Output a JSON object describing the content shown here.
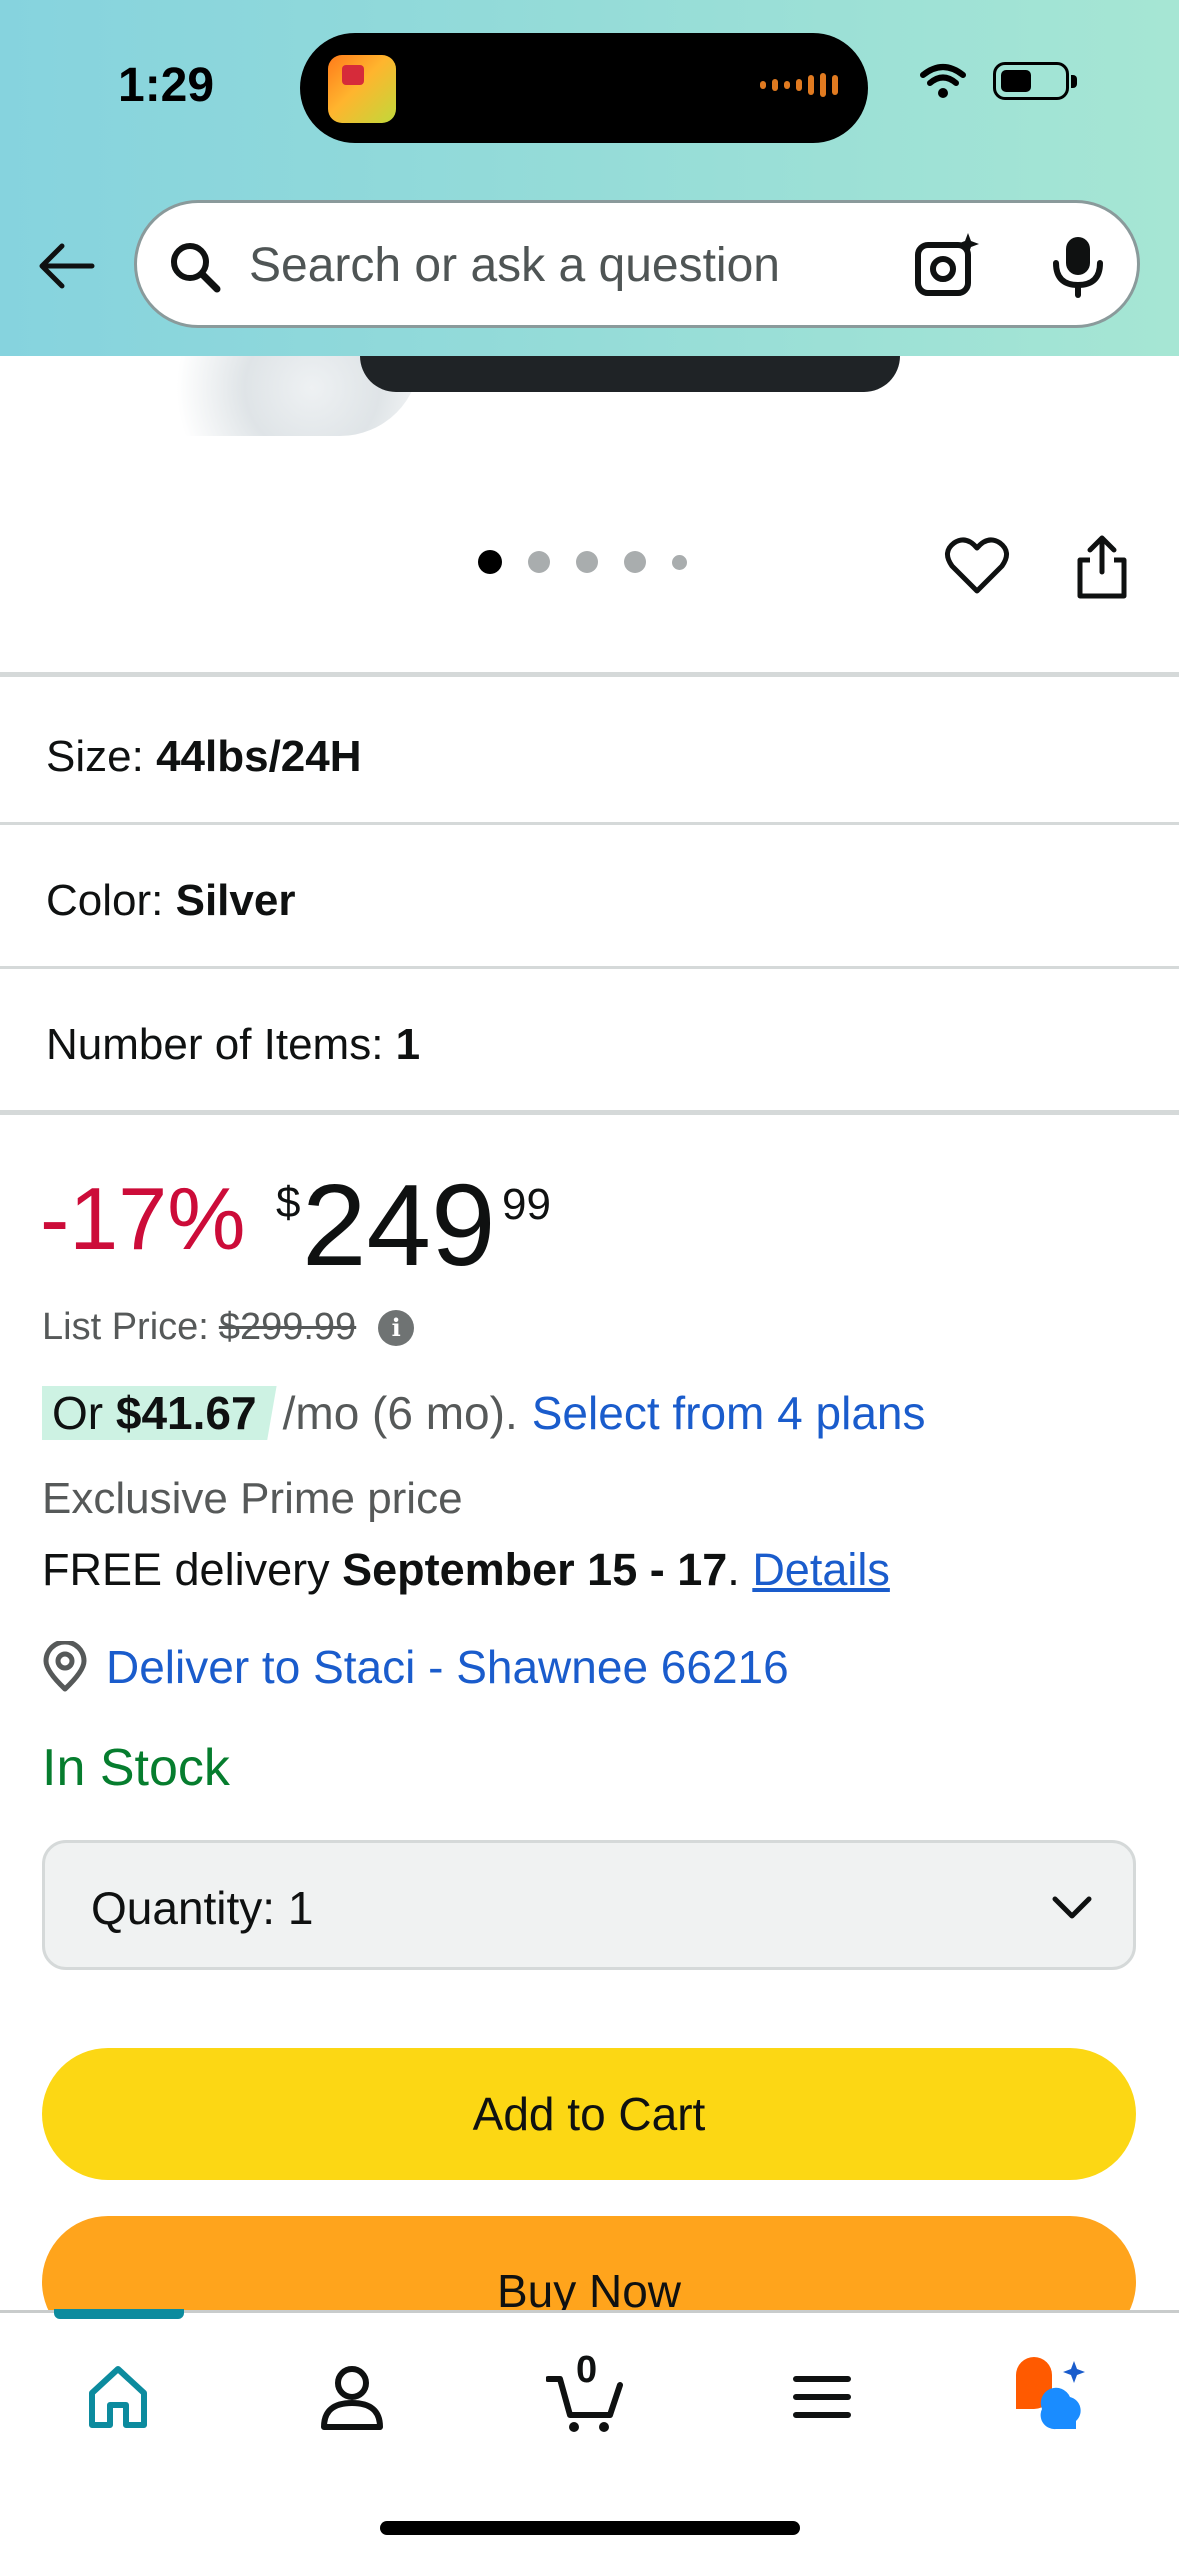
{
  "status_bar": {
    "time": "1:29"
  },
  "search": {
    "placeholder": "Search or ask a question"
  },
  "carousel": {
    "total_images": 5,
    "active_index": 0
  },
  "variants": {
    "size_label": "Size:",
    "size_value": "44lbs/24H",
    "color_label": "Color:",
    "color_value": "Silver",
    "items_label": "Number of Items:",
    "items_value": "1"
  },
  "price": {
    "discount": "-17%",
    "currency_symbol": "$",
    "whole": "249",
    "fraction": "99",
    "list_price_label": "List Price:",
    "list_price_value": "$299.99",
    "monthly_prefix": "Or",
    "monthly_amount": "$41.67",
    "monthly_terms": "/mo (6 mo).",
    "plans_link": "Select from 4 plans",
    "exclusive": "Exclusive Prime price"
  },
  "delivery": {
    "prefix": "FREE delivery",
    "dates": "September 15 - 17",
    "suffix": ".",
    "details_link": "Details",
    "deliver_to": "Deliver to Staci - Shawnee 66216"
  },
  "stock": {
    "status": "In Stock"
  },
  "quantity": {
    "label": "Quantity:",
    "value": "1"
  },
  "buttons": {
    "add_to_cart": "Add to Cart",
    "buy_now": "Buy Now"
  },
  "tabbar": {
    "cart_count": "0",
    "active_tab": "home"
  },
  "colors": {
    "discount": "#cc0c39",
    "in_stock": "#067d2e",
    "link": "#1a5ccc",
    "add_to_cart": "#fcd714",
    "buy_now": "#ffa41c",
    "active_tab": "#0c8b9e"
  }
}
